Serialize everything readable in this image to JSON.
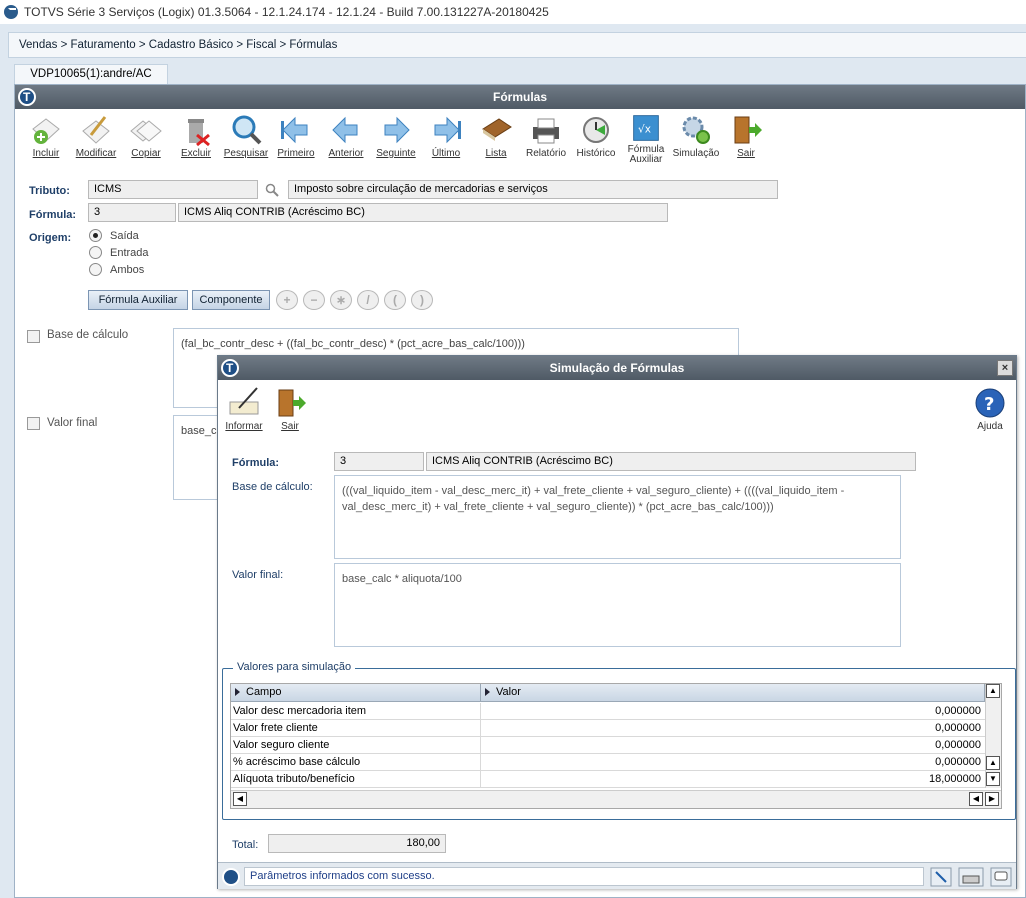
{
  "window": {
    "title": "TOTVS Série 3 Serviços (Logix) 01.3.5064 - 12.1.24.174 - 12.1.24 - Build 7.00.131227A-20180425"
  },
  "breadcrumb": "Vendas > Faturamento > Cadastro Básico > Fiscal > Fórmulas",
  "tab": {
    "label": "VDP10065(1):andre/AC"
  },
  "panel": {
    "title": "Fórmulas"
  },
  "toolbar": {
    "items": [
      {
        "label": "Incluir",
        "icon": "add-icon"
      },
      {
        "label": "Modificar",
        "icon": "edit-icon"
      },
      {
        "label": "Copiar",
        "icon": "copy-icon"
      },
      {
        "label": "Excluir",
        "icon": "trash-icon"
      },
      {
        "label": "Pesquisar",
        "icon": "search-icon"
      },
      {
        "label": "Primeiro",
        "icon": "first-icon"
      },
      {
        "label": "Anterior",
        "icon": "previous-icon"
      },
      {
        "label": "Seguinte",
        "icon": "next-icon"
      },
      {
        "label": "Último",
        "icon": "last-icon"
      },
      {
        "label": "Lista",
        "icon": "book-icon"
      },
      {
        "label": "Relatório",
        "icon": "printer-icon"
      },
      {
        "label": "Histórico",
        "icon": "history-icon"
      },
      {
        "label": "Fórmula",
        "label2": "Auxiliar",
        "icon": "formula-icon"
      },
      {
        "label": "Simulação",
        "icon": "gears-icon"
      },
      {
        "label": "Sair",
        "icon": "exit-door-icon"
      }
    ]
  },
  "form": {
    "tributo_label": "Tributo:",
    "tributo_code": "ICMS",
    "tributo_desc": "Imposto sobre circulação de mercadorias e serviços",
    "formula_label": "Fórmula:",
    "formula_code": "3",
    "formula_desc": "ICMS Aliq CONTRIB (Acréscimo BC)",
    "origem_label": "Origem:",
    "origem_options": [
      "Saída",
      "Entrada",
      "Ambos"
    ],
    "origem_selected": "Saída",
    "btn_formula_aux": "Fórmula Auxiliar",
    "btn_componente": "Componente",
    "operators": [
      "+",
      "−",
      "∗",
      "/",
      "(",
      ")"
    ],
    "base_calc_label": "Base de cálculo",
    "base_calc_value": "(fal_bc_contr_desc + ((fal_bc_contr_desc) * (pct_acre_bas_calc/100)))",
    "valor_final_label": "Valor final",
    "valor_final_value": "base_ca"
  },
  "dialog": {
    "title": "Simulação de Fórmulas",
    "close": "×",
    "toolbar": [
      {
        "label": "Informar",
        "icon": "pen-paper-icon"
      },
      {
        "label": "Sair",
        "icon": "exit-door-icon"
      }
    ],
    "help_label": "Ajuda",
    "formula_label": "Fórmula:",
    "formula_code": "3",
    "formula_desc": "ICMS Aliq CONTRIB (Acréscimo BC)",
    "base_calc_label": "Base de cálculo:",
    "base_calc_value": "(((val_liquido_item - val_desc_merc_it) + val_frete_cliente + val_seguro_cliente) + ((((val_liquido_item - val_desc_merc_it) + val_frete_cliente + val_seguro_cliente)) * (pct_acre_bas_calc/100)))",
    "valor_final_label": "Valor final:",
    "valor_final_value": "base_calc * aliquota/100",
    "group_title": "Valores para simulação",
    "grid": {
      "columns": [
        "Campo",
        "Valor"
      ],
      "rows": [
        {
          "campo": "Valor desc mercadoria item",
          "valor": "0,000000"
        },
        {
          "campo": "Valor frete cliente",
          "valor": "0,000000"
        },
        {
          "campo": "Valor seguro cliente",
          "valor": "0,000000"
        },
        {
          "campo": "% acréscimo base cálculo",
          "valor": "0,000000"
        },
        {
          "campo": "Alíquota tributo/benefício",
          "valor": "18,000000"
        }
      ]
    },
    "total_label": "Total:",
    "total_value": "180,00",
    "status_text": "Parâmetros informados com sucesso."
  }
}
